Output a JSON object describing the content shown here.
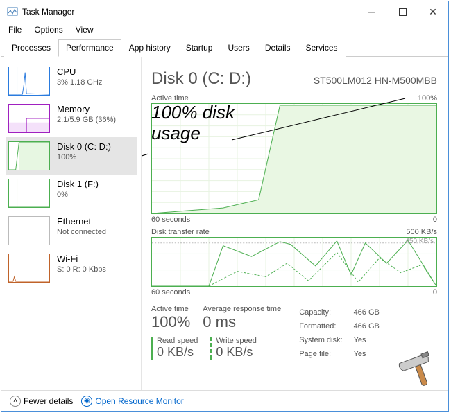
{
  "window": {
    "title": "Task Manager"
  },
  "menu": {
    "file": "File",
    "options": "Options",
    "view": "View"
  },
  "tabs": [
    {
      "label": "Processes"
    },
    {
      "label": "Performance"
    },
    {
      "label": "App history"
    },
    {
      "label": "Startup"
    },
    {
      "label": "Users"
    },
    {
      "label": "Details"
    },
    {
      "label": "Services"
    }
  ],
  "sidebar": {
    "cpu": {
      "name": "CPU",
      "sub": "3%  1.18 GHz",
      "color": "#2a7bde"
    },
    "memory": {
      "name": "Memory",
      "sub": "2.1/5.9 GB (36%)",
      "color": "#a020c0"
    },
    "disk0": {
      "name": "Disk 0 (C: D:)",
      "sub": "100%",
      "color": "#4caf50"
    },
    "disk1": {
      "name": "Disk 1 (F:)",
      "sub": "0%",
      "color": "#4caf50"
    },
    "ethernet": {
      "name": "Ethernet",
      "sub": "Not connected",
      "color": "#888"
    },
    "wifi": {
      "name": "Wi-Fi",
      "sub": "S: 0 R: 0 Kbps",
      "color": "#c0632a"
    }
  },
  "main": {
    "title": "Disk 0 (C: D:)",
    "model": "ST500LM012 HN-M500MBB",
    "graph1": {
      "label": "Active time",
      "max": "100%",
      "xleft": "60 seconds",
      "xright": "0"
    },
    "graph2": {
      "label": "Disk transfer rate",
      "max": "500 KB/s",
      "mid": "450 KB/s",
      "xleft": "60 seconds",
      "xright": "0"
    },
    "stats": {
      "active_lbl": "Active time",
      "active_val": "100%",
      "avg_lbl": "Average response time",
      "avg_val": "0 ms",
      "read_lbl": "Read speed",
      "read_val": "0 KB/s",
      "write_lbl": "Write speed",
      "write_val": "0 KB/s"
    },
    "props": {
      "capacity_k": "Capacity:",
      "capacity_v": "466 GB",
      "formatted_k": "Formatted:",
      "formatted_v": "466 GB",
      "sysdisk_k": "System disk:",
      "sysdisk_v": "Yes",
      "pagefile_k": "Page file:",
      "pagefile_v": "Yes"
    }
  },
  "footer": {
    "fewer": "Fewer details",
    "orm": "Open Resource Monitor"
  },
  "annotation": {
    "line1": "100% disk",
    "line2": "usage"
  },
  "chart_data": [
    {
      "type": "area",
      "title": "Active time",
      "ylabel": "Active time",
      "ylim": [
        0,
        100
      ],
      "xlabel": "seconds ago",
      "xlim": [
        60,
        0
      ],
      "series": [
        {
          "name": "Active time %",
          "x": [
            60,
            45,
            40,
            35,
            30,
            25,
            20,
            15,
            10,
            5,
            0
          ],
          "values": [
            0,
            5,
            10,
            100,
            100,
            100,
            100,
            100,
            100,
            100,
            100
          ]
        }
      ]
    },
    {
      "type": "line",
      "title": "Disk transfer rate",
      "ylabel": "KB/s",
      "ylim": [
        0,
        500
      ],
      "xlabel": "seconds ago",
      "xlim": [
        60,
        0
      ],
      "series": [
        {
          "name": "Read speed",
          "x": [
            60,
            50,
            45,
            40,
            35,
            30,
            28,
            25,
            20,
            18,
            15,
            10,
            5,
            0
          ],
          "values": [
            0,
            0,
            420,
            350,
            300,
            480,
            450,
            200,
            460,
            120,
            430,
            220,
            470,
            0
          ]
        },
        {
          "name": "Write speed",
          "x": [
            60,
            50,
            45,
            40,
            35,
            30,
            25,
            20,
            15,
            10,
            5,
            0
          ],
          "values": [
            0,
            0,
            150,
            100,
            220,
            60,
            300,
            40,
            280,
            90,
            200,
            0
          ]
        }
      ],
      "annotations": [
        "450 KB/s"
      ]
    }
  ]
}
